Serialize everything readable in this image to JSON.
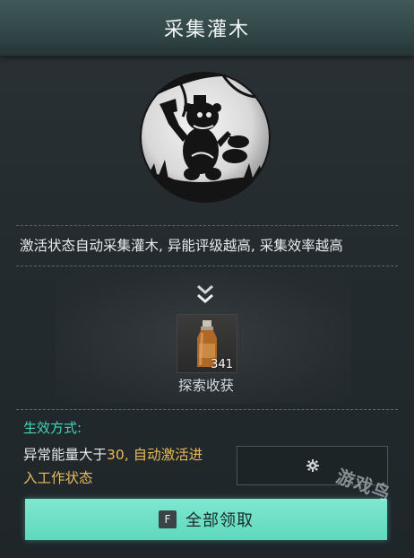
{
  "title": "采集灌木",
  "description": "激活状态自动采集灌木, 异能评级越高, 采集效率越高",
  "reward": {
    "item_icon": "bottle-icon",
    "count": "341",
    "label": "探索收获"
  },
  "effect": {
    "heading": "生效方式:",
    "text_prefix": "异常能量大于",
    "threshold": "30",
    "text_highlight_rest": ", 自动激活进",
    "text_suffix": "入工作状态"
  },
  "settings_icon": "gear-icon",
  "claim_button": {
    "key": "F",
    "label": "全部领取"
  },
  "watermark": "游戏鸟",
  "colors": {
    "accent_green": "#42d4b4",
    "button_green": "#6ddfc5",
    "highlight_gold": "#e9b95a"
  }
}
